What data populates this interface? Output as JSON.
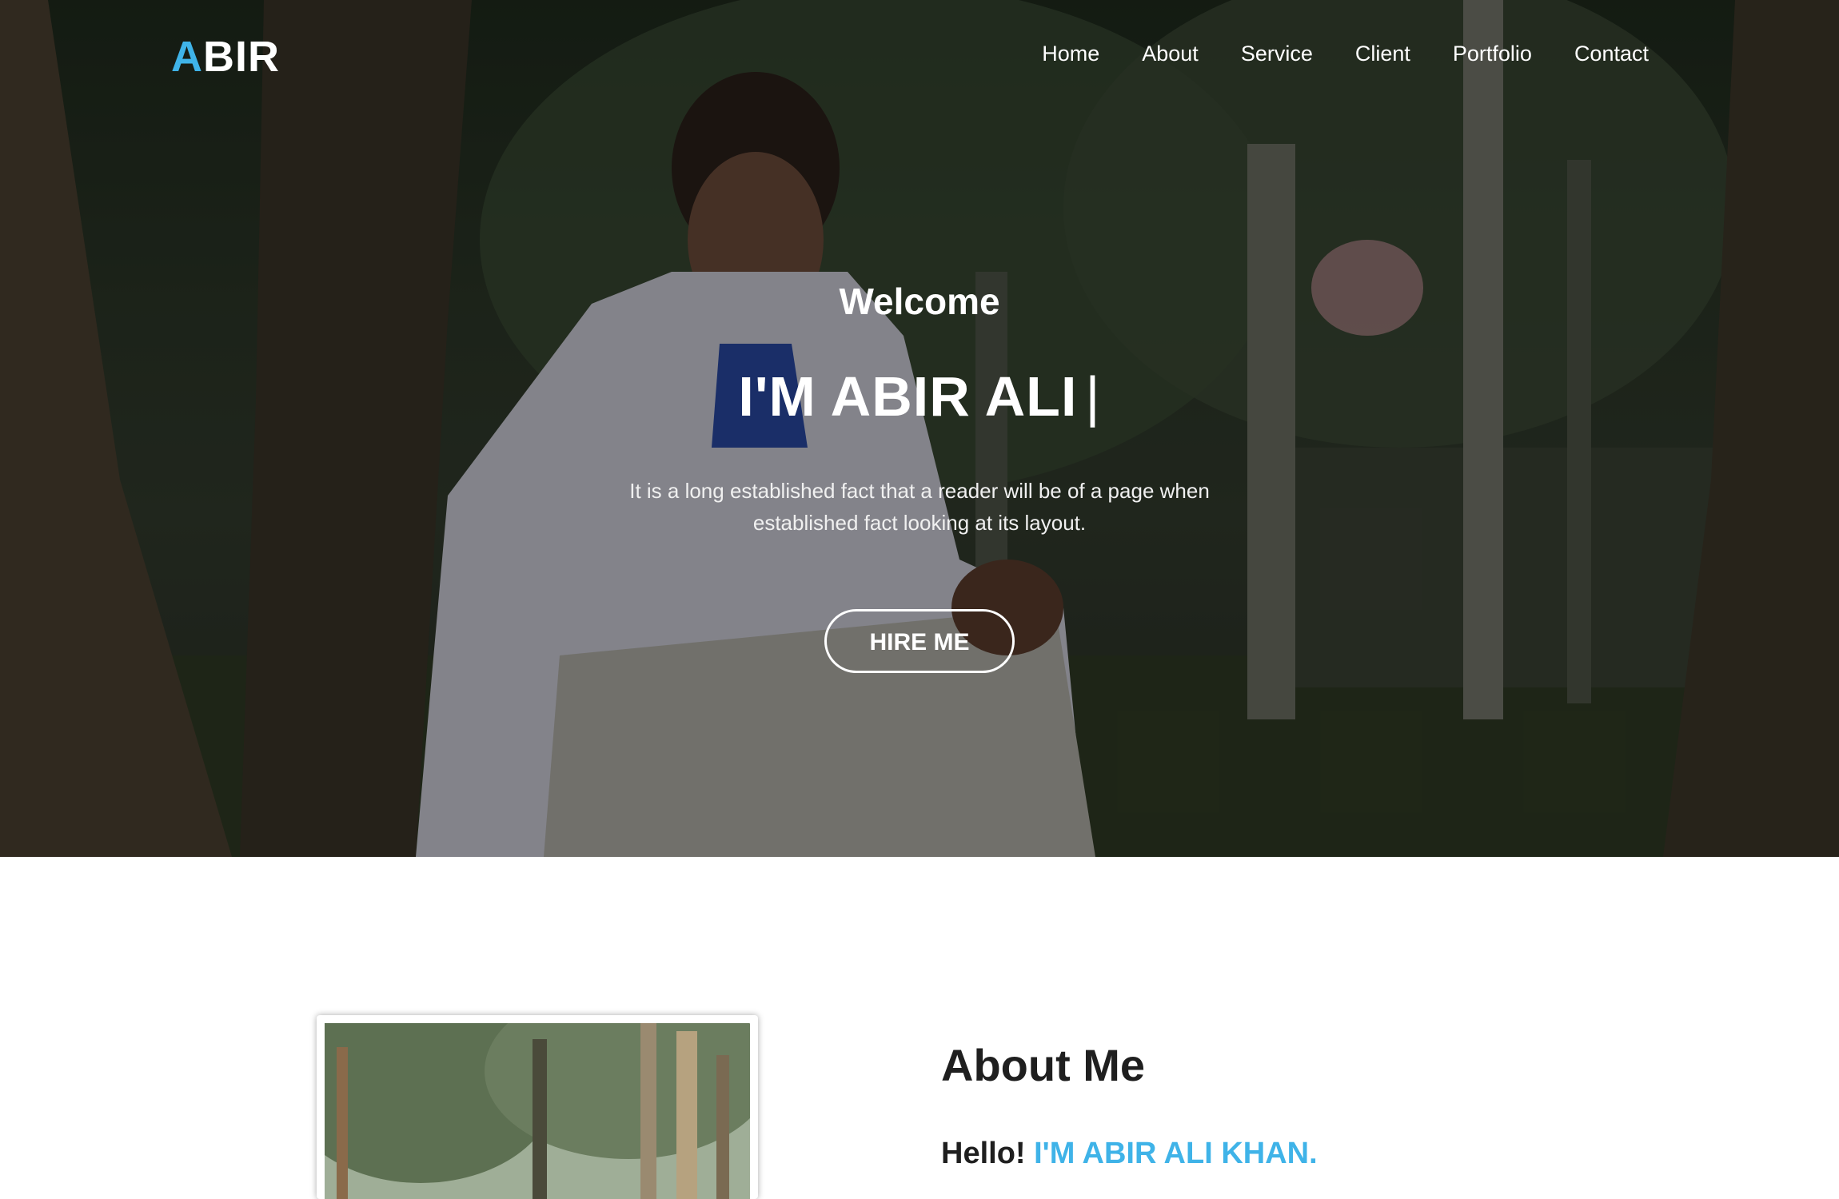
{
  "brand": {
    "logo_first": "A",
    "logo_rest": "BIR",
    "accent_color": "#3fb3e8"
  },
  "nav": {
    "items": [
      {
        "label": "Home"
      },
      {
        "label": "About"
      },
      {
        "label": "Service"
      },
      {
        "label": "Client"
      },
      {
        "label": "Portfolio"
      },
      {
        "label": "Contact"
      }
    ]
  },
  "hero": {
    "welcome": "Welcome",
    "title": "I'M ABIR ALI",
    "cursor": "|",
    "description": "It is a long established fact that a reader will be of a page when established fact looking at its layout.",
    "button_label": "HIRE ME"
  },
  "about": {
    "heading": "About Me",
    "hello": "Hello!",
    "name": "I'M ABIR ALI KHAN."
  }
}
